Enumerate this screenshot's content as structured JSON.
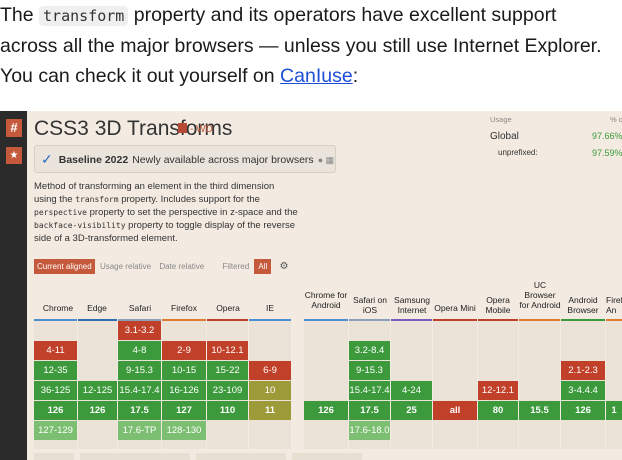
{
  "article": {
    "line1_pre": "The ",
    "code": "transform",
    "line1_post": " property and its operators have excellent support",
    "line2": "across all the major browsers — unless you still use Internet Explorer.",
    "line3_pre": "You can check it out yourself on ",
    "link": "CanIuse",
    "line3_post": ":"
  },
  "caniuse": {
    "hash": "#",
    "star": "★",
    "title": "CSS3 3D Transforms",
    "status": "- WD",
    "baseline_label": "Baseline 2022",
    "baseline_text": "Newly available across major browsers",
    "desc1": "Method of transforming an element in the third dimension",
    "desc2_pre": "using the ",
    "desc2_code": "transform",
    "desc2_post": " property. Includes support for the",
    "desc3_code": "perspective",
    "desc3_post": " property to set the perspective in z-space and the",
    "desc4_code": "backface-visibility",
    "desc4_post": " property to toggle display of the reverse",
    "desc5": "side of a 3D-transformed element.",
    "usage": {
      "label": "Usage",
      "pct_label": "% o",
      "global_label": "Global",
      "global_value": "97.66%",
      "unprefixed_label": "unprefixed:",
      "unprefixed_value": "97.59%"
    },
    "tabs": {
      "current": "Current aligned",
      "relative": "Usage relative",
      "date": "Date relative",
      "filtered": "Filtered",
      "all": "All"
    },
    "browsers": {
      "chrome": "Chrome",
      "edge": "Edge",
      "safari": "Safari",
      "firefox": "Firefox",
      "opera": "Opera",
      "ie": "IE",
      "chrome_android": "Chrome for Android",
      "safari_ios": "Safari on iOS",
      "samsung": "Samsung Internet",
      "opera_mini": "Opera Mini",
      "opera_mobile": "Opera Mobile",
      "uc": "UC Browser for Android",
      "android": "Android Browser",
      "firefox_android": "Firefo An"
    },
    "cells": {
      "chrome": [
        "4-11",
        "12-35",
        "36-125",
        "126",
        "127-129"
      ],
      "edge": [
        "12-125",
        "126"
      ],
      "safari": [
        "3.1-3.2",
        "4-8",
        "9-15.3",
        "15.4-17.4",
        "17.5",
        "17.6-TP"
      ],
      "firefox": [
        "2-9",
        "10-15",
        "16-126",
        "127",
        "128-130"
      ],
      "opera": [
        "10-12.1",
        "15-22",
        "23-109",
        "110"
      ],
      "ie": [
        "6-9",
        "10",
        "11"
      ],
      "chrome_android": [
        "126"
      ],
      "safari_ios": [
        "3.2-8.4",
        "9-15.3",
        "15.4-17.4",
        "17.5",
        "17.6-18.0"
      ],
      "samsung": [
        "4-24",
        "25"
      ],
      "opera_mini": [
        "all"
      ],
      "opera_mobile": [
        "12-12.1",
        "80"
      ],
      "uc": [
        "15.5"
      ],
      "android": [
        "2.1-2.3",
        "3-4.4.4",
        "126"
      ],
      "firefox_android": [
        "1"
      ]
    },
    "colors": {
      "supported": "#3c9a3c",
      "unsupported": "#c1402a",
      "partial": "#9d9a3a",
      "accent": "#c5593b"
    }
  }
}
